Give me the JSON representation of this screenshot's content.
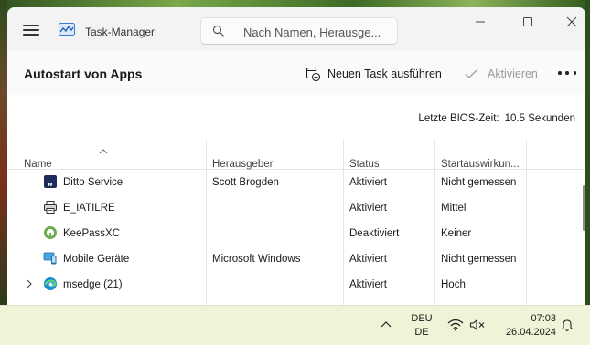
{
  "window": {
    "title": "Task-Manager"
  },
  "search": {
    "placeholder": "Nach Namen, Herausge..."
  },
  "toolbar": {
    "page_title": "Autostart von Apps",
    "run_task_label": "Neuen Task ausführen",
    "activate_label": "Aktivieren"
  },
  "bios": {
    "label": "Letzte BIOS-Zeit:",
    "value": "10.5 Sekunden"
  },
  "table": {
    "columns": [
      "Name",
      "Herausgeber",
      "Status",
      "Startauswirkun..."
    ],
    "rows": [
      {
        "name": "Ditto Service",
        "publisher": "Scott Brogden",
        "status": "Aktiviert",
        "impact": "Nicht gemessen",
        "icon": "ditto-icon"
      },
      {
        "name": "E_IATILRE",
        "publisher": "",
        "status": "Aktiviert",
        "impact": "Mittel",
        "icon": "printer-icon"
      },
      {
        "name": "KeePassXC",
        "publisher": "",
        "status": "Deaktiviert",
        "impact": "Keiner",
        "icon": "keepassxc-icon"
      },
      {
        "name": "Mobile Geräte",
        "publisher": "Microsoft Windows",
        "status": "Aktiviert",
        "impact": "Nicht gemessen",
        "icon": "phone-link-icon"
      },
      {
        "name": "msedge (21)",
        "publisher": "",
        "status": "Aktiviert",
        "impact": "Hoch",
        "icon": "edge-icon"
      }
    ]
  },
  "taskbar": {
    "lang_line1": "DEU",
    "lang_line2": "DE",
    "time": "07:03",
    "date": "26.04.2024"
  },
  "colors": {
    "accent": "#0067c0",
    "taskbar": "#f1f3d9",
    "titlebar": "#f3f3f3"
  }
}
